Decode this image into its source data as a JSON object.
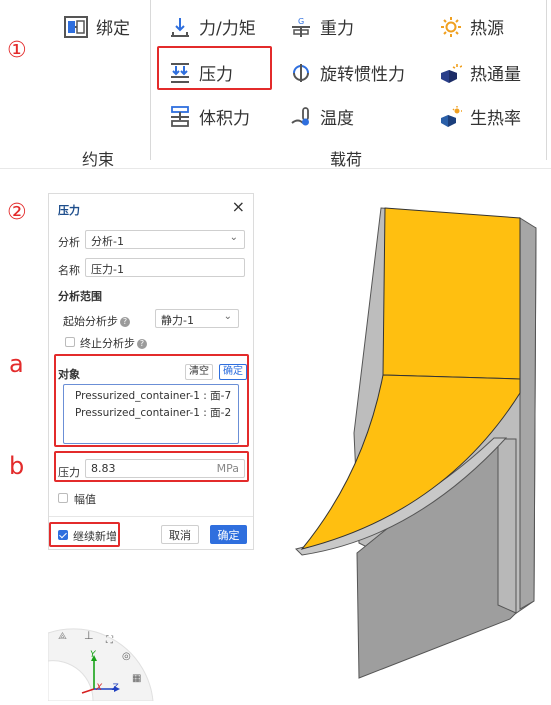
{
  "ribbon": {
    "constraint": {
      "bind_label": "绑定",
      "group_label": "约束"
    },
    "load": {
      "group_label": "载荷",
      "force_moment": "力/力矩",
      "pressure": "压力",
      "body_force": "体积力",
      "gravity": "重力",
      "rotational_inertia": "旋转惯性力",
      "temperature": "温度",
      "heat_source": "热源",
      "heat_flux": "热通量",
      "heat_generation": "生热率"
    }
  },
  "markers": {
    "step1": "①",
    "step2": "②",
    "a": "a",
    "b": "b"
  },
  "panel": {
    "title": "压力",
    "close": "×",
    "analysis_label": "分析",
    "analysis_value": "分析-1",
    "name_label": "名称",
    "name_value": "压力-1",
    "scope_header": "分析范围",
    "start_step_label": "起始分析步",
    "start_step_value": "静力-1",
    "end_step_label": "终止分析步",
    "end_step_checked": false,
    "object_label": "对象",
    "clear_button": "清空",
    "confirm_small_button": "确定",
    "objects": [
      "Pressurized_container-1 : 面-7",
      "Pressurized_container-1 : 面-2"
    ],
    "pressure_label": "压力",
    "pressure_value": "8.83",
    "pressure_unit": "MPa",
    "amplitude_label": "幅值",
    "amplitude_checked": false,
    "continue_label": "继续新增",
    "continue_checked": true,
    "cancel_button": "取消",
    "ok_button": "确定"
  },
  "colors": {
    "accent": "#2f6fde",
    "highlight": "#e32b2b",
    "surface_selected": "#ffbf10",
    "model_gray": "#a9a9a9"
  },
  "viewcube": {
    "axis_y": "Y",
    "axis_x": "X",
    "axis_z": "Z"
  }
}
